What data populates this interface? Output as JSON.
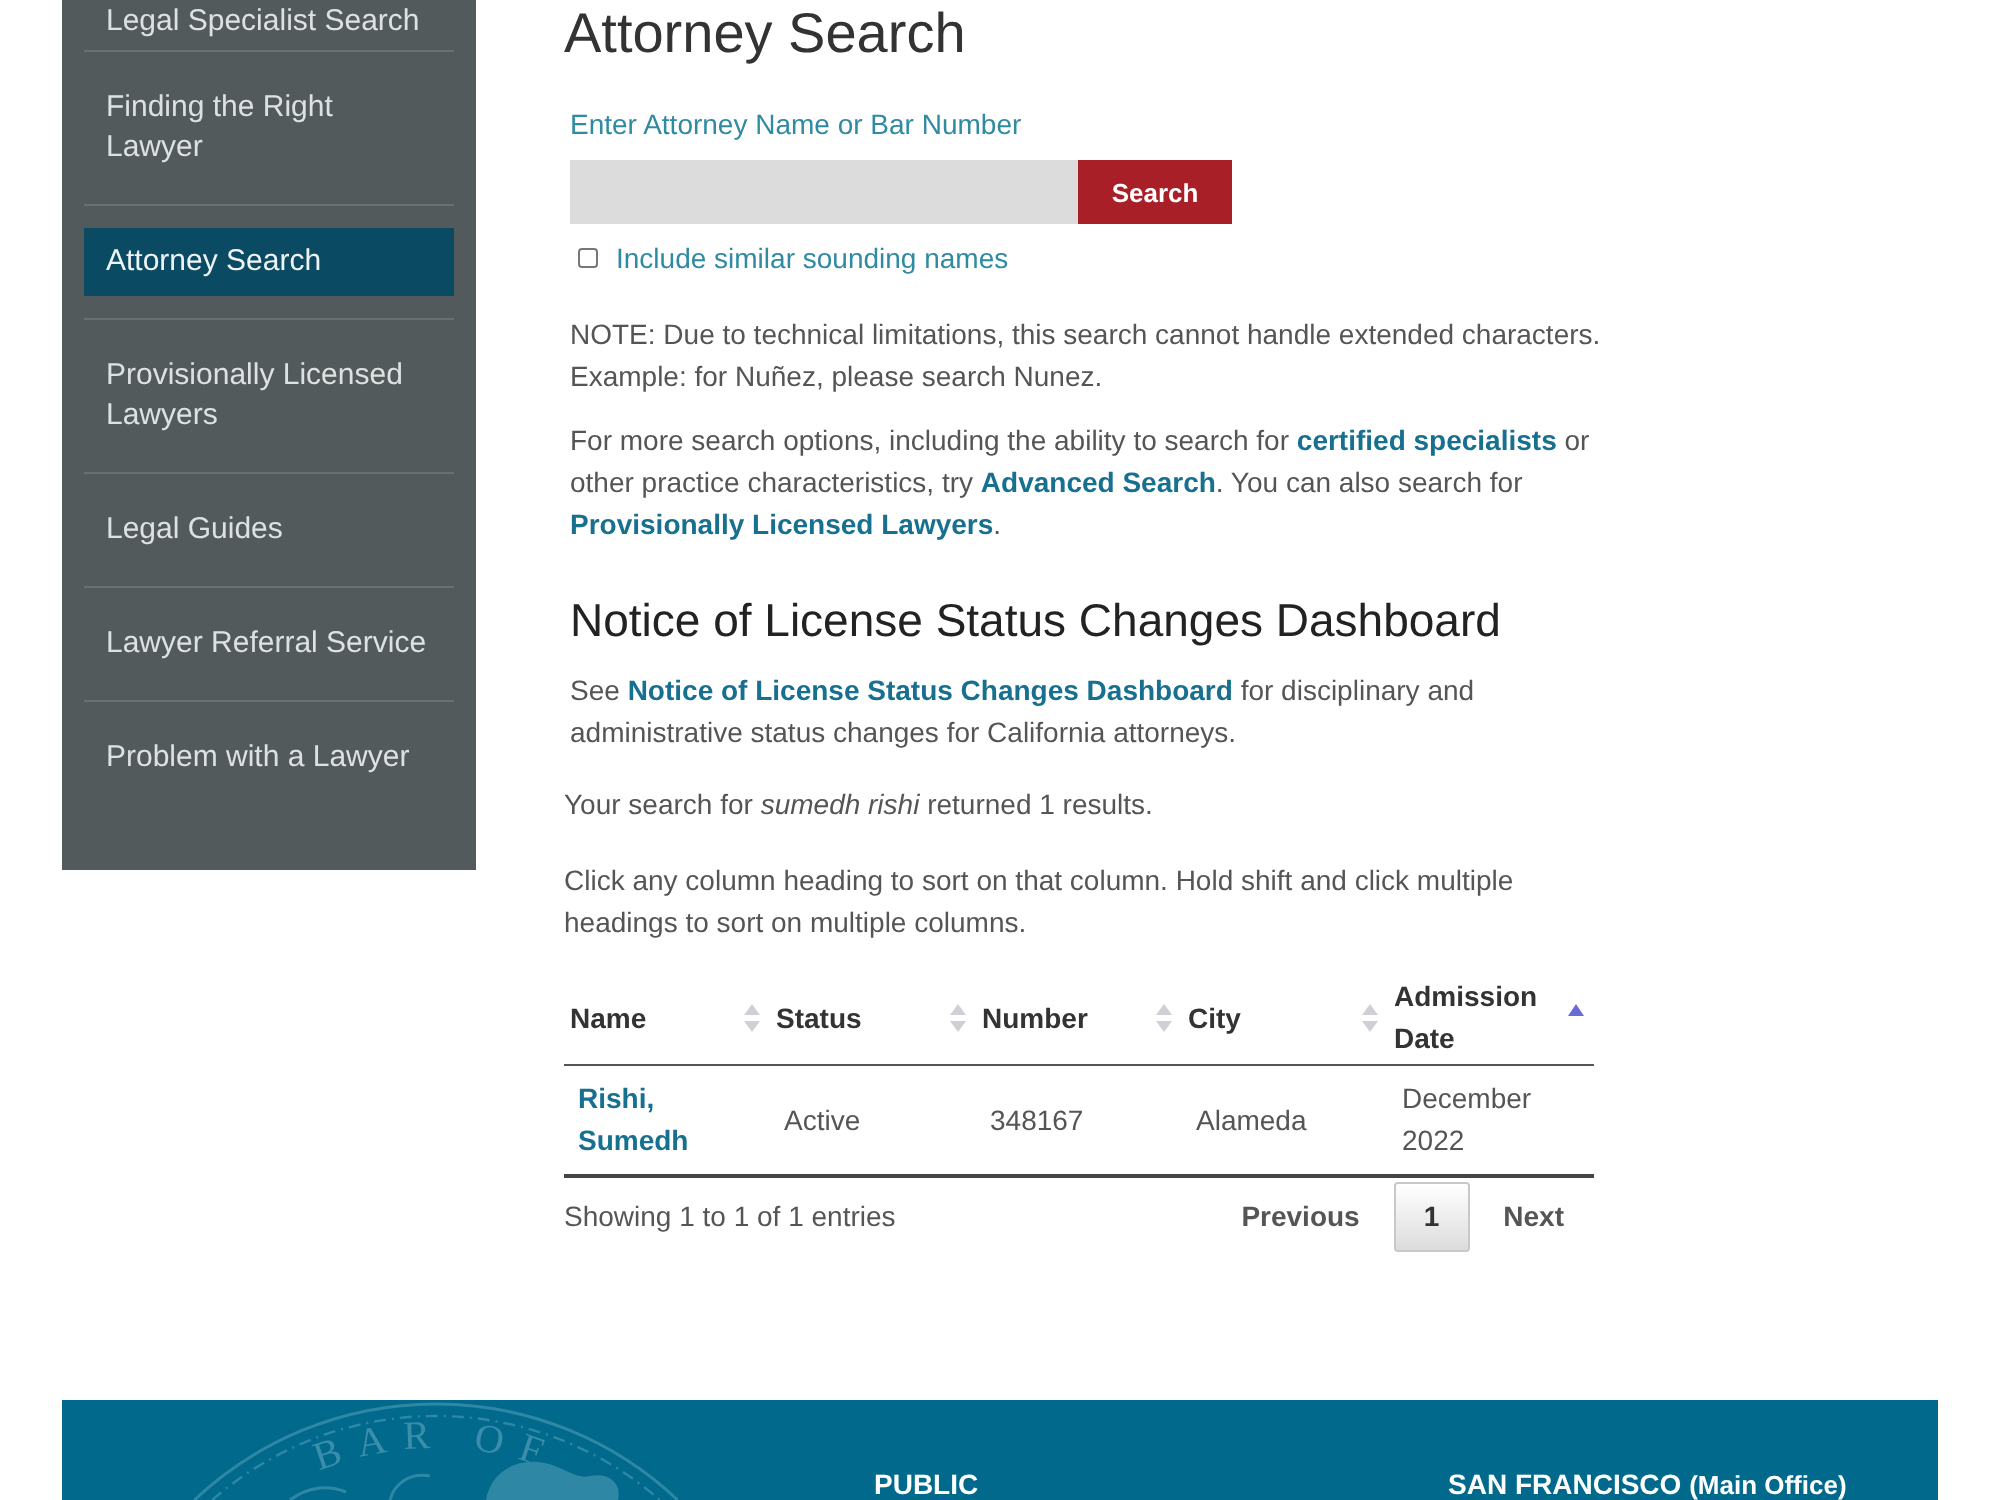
{
  "sidebar": {
    "items": [
      {
        "label": "Legal Specialist Search",
        "selected": false
      },
      {
        "label": "Finding the Right Lawyer",
        "selected": false
      },
      {
        "label": "Attorney Search",
        "selected": true
      },
      {
        "label": "Provisionally Licensed Lawyers",
        "selected": false
      },
      {
        "label": "Legal Guides",
        "selected": false
      },
      {
        "label": "Lawyer Referral Service",
        "selected": false
      },
      {
        "label": "Problem with a Lawyer",
        "selected": false
      }
    ]
  },
  "page_title": "Attorney Search",
  "search": {
    "label": "Enter Attorney Name or Bar Number",
    "button": "Search",
    "similar_names": {
      "label": "Include similar sounding names",
      "checked": false
    }
  },
  "notes": [
    [
      {
        "kind": "text",
        "text": "NOTE: Due to technical limitations, this search cannot handle extended characters. Example: for Nuñez, please search Nunez."
      }
    ],
    [
      {
        "kind": "text",
        "text": "For more search options, including the ability to search for "
      },
      {
        "kind": "link",
        "text": "certified specialists"
      },
      {
        "kind": "text",
        "text": " or other practice characteristics, try "
      },
      {
        "kind": "link",
        "text": "Advanced Search"
      },
      {
        "kind": "text",
        "text": ". You can also search for "
      },
      {
        "kind": "link",
        "text": "Provisionally Licensed Lawyers"
      },
      {
        "kind": "text",
        "text": "."
      }
    ]
  ],
  "dashboard": {
    "title": "Notice of License Status Changes Dashboard",
    "text": [
      {
        "kind": "text",
        "text": "See "
      },
      {
        "kind": "link",
        "text": "Notice of License Status Changes Dashboard"
      },
      {
        "kind": "text",
        "text": " for disciplinary and administrative status changes for California attorneys."
      }
    ]
  },
  "results_summary": "Your search for *sumedh rishi* returned 1 results.",
  "sort_hint": "Click any column heading to sort on that column. Hold shift and click multiple headings to sort on multiple columns.",
  "table": {
    "columns": [
      {
        "label": "Name",
        "sorted": false
      },
      {
        "label": "Status",
        "sorted": false
      },
      {
        "label": "Number",
        "sorted": false
      },
      {
        "label": "City",
        "sorted": false
      },
      {
        "label": "Admission Date",
        "sorted": true
      }
    ],
    "rows": [
      {
        "cells": [
          {
            "kind": "link",
            "text": "Rishi, Sumedh"
          },
          {
            "kind": "text",
            "text": "Active"
          },
          {
            "kind": "text",
            "text": "348167"
          },
          {
            "kind": "text",
            "text": "Alameda"
          },
          {
            "kind": "text",
            "text": "December 2022"
          }
        ]
      }
    ],
    "info": "Showing 1 to 1 of 1 entries",
    "pagination": {
      "previous": "Previous",
      "pages": [
        {
          "label": "1",
          "selected": true
        }
      ],
      "next": "Next"
    }
  },
  "footer": {
    "seal_text": "BAR OF",
    "columns": [
      {
        "title": "PUBLIC"
      },
      {
        "title": "SAN FRANCISCO",
        "note": "(Main Office)"
      }
    ]
  }
}
